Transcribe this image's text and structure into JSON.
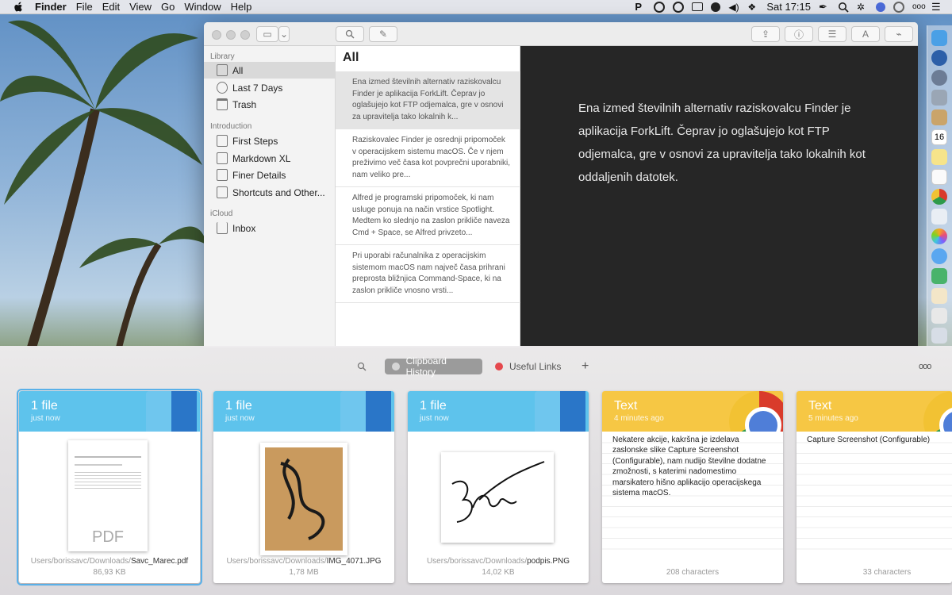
{
  "menubar": {
    "app": "Finder",
    "menus": [
      "File",
      "Edit",
      "View",
      "Go",
      "Window",
      "Help"
    ],
    "clock": "Sat 17:15"
  },
  "bear": {
    "sidebar": {
      "sections": {
        "library": "Library",
        "introduction": "Introduction",
        "icloud": "iCloud"
      },
      "library_items": [
        "All",
        "Last 7 Days",
        "Trash"
      ],
      "intro_items": [
        "First Steps",
        "Markdown XL",
        "Finer Details",
        "Shortcuts and Other..."
      ],
      "icloud_items": [
        "Inbox"
      ],
      "selected": "All"
    },
    "notes_title": "All",
    "notes": [
      "Ena izmed številnih alternativ raziskovalcu Finder je aplikacija ForkLift. Čeprav jo oglašujejo kot FTP odjemalca, gre v osnovi za upravitelja tako lokalnih k...",
      "Raziskovalec Finder je osrednji pripomoček v operacijskem sistemu macOS. Če v njem preživimo več časa kot povprečni uporabniki, nam veliko pre...",
      "Alfred je programski pripomoček, ki nam usluge ponuja na način vrstice Spotlight. Medtem ko slednjo na zaslon prikliče naveza Cmd + Space, se Alfred privzeto...",
      "Pri uporabi računalnika z operacijskim sistemom macOS nam največ časa prihrani preprosta bližnjica Command-Space, ki na zaslon prikliče vnosno vrsti..."
    ],
    "editor_text": "Ena izmed številnih alternativ raziskovalcu Finder je aplikacija ForkLift. Čeprav jo oglašujejo kot FTP odjemalca, gre v osnovi za upravitelja tako lokalnih kot oddaljenih datotek."
  },
  "paste": {
    "tabs": {
      "clipboard": "Clipboard History",
      "links": "Useful Links"
    },
    "add": "+",
    "more": "ooo",
    "cards": [
      {
        "title": "1 file",
        "time": "just now",
        "path_prefix": "Users/borissavc/Downloads/",
        "file": "Savc_Marec.pdf",
        "size": "86,93 KB",
        "thumb_label": "PDF"
      },
      {
        "title": "1 file",
        "time": "just now",
        "path_prefix": "Users/borissavc/Downloads/",
        "file": "IMG_4071.JPG",
        "size": "1,78 MB"
      },
      {
        "title": "1 file",
        "time": "just now",
        "path_prefix": "Users/borissavc/Downloads/",
        "file": "podpis.PNG",
        "size": "14,02 KB"
      },
      {
        "title": "Text",
        "time": "4 minutes ago",
        "text": "Nekatere akcije, kakršna je izdelava zaslonske slike Capture Screenshot (Configurable), nam nudijo številne dodatne zmožnosti, s katerimi nadomestimo marsikatero hišno aplikacijo operacijskega sistema macOS.",
        "chars": "208 characters"
      },
      {
        "title": "Text",
        "time": "5 minutes ago",
        "text": "Capture Screenshot (Configurable)",
        "chars": "33 characters"
      }
    ]
  },
  "colors": {
    "accent_blue": "#5ec3ec",
    "accent_yellow": "#f6c744",
    "editor_bg": "#262626",
    "links_dot": "#e5484d"
  }
}
